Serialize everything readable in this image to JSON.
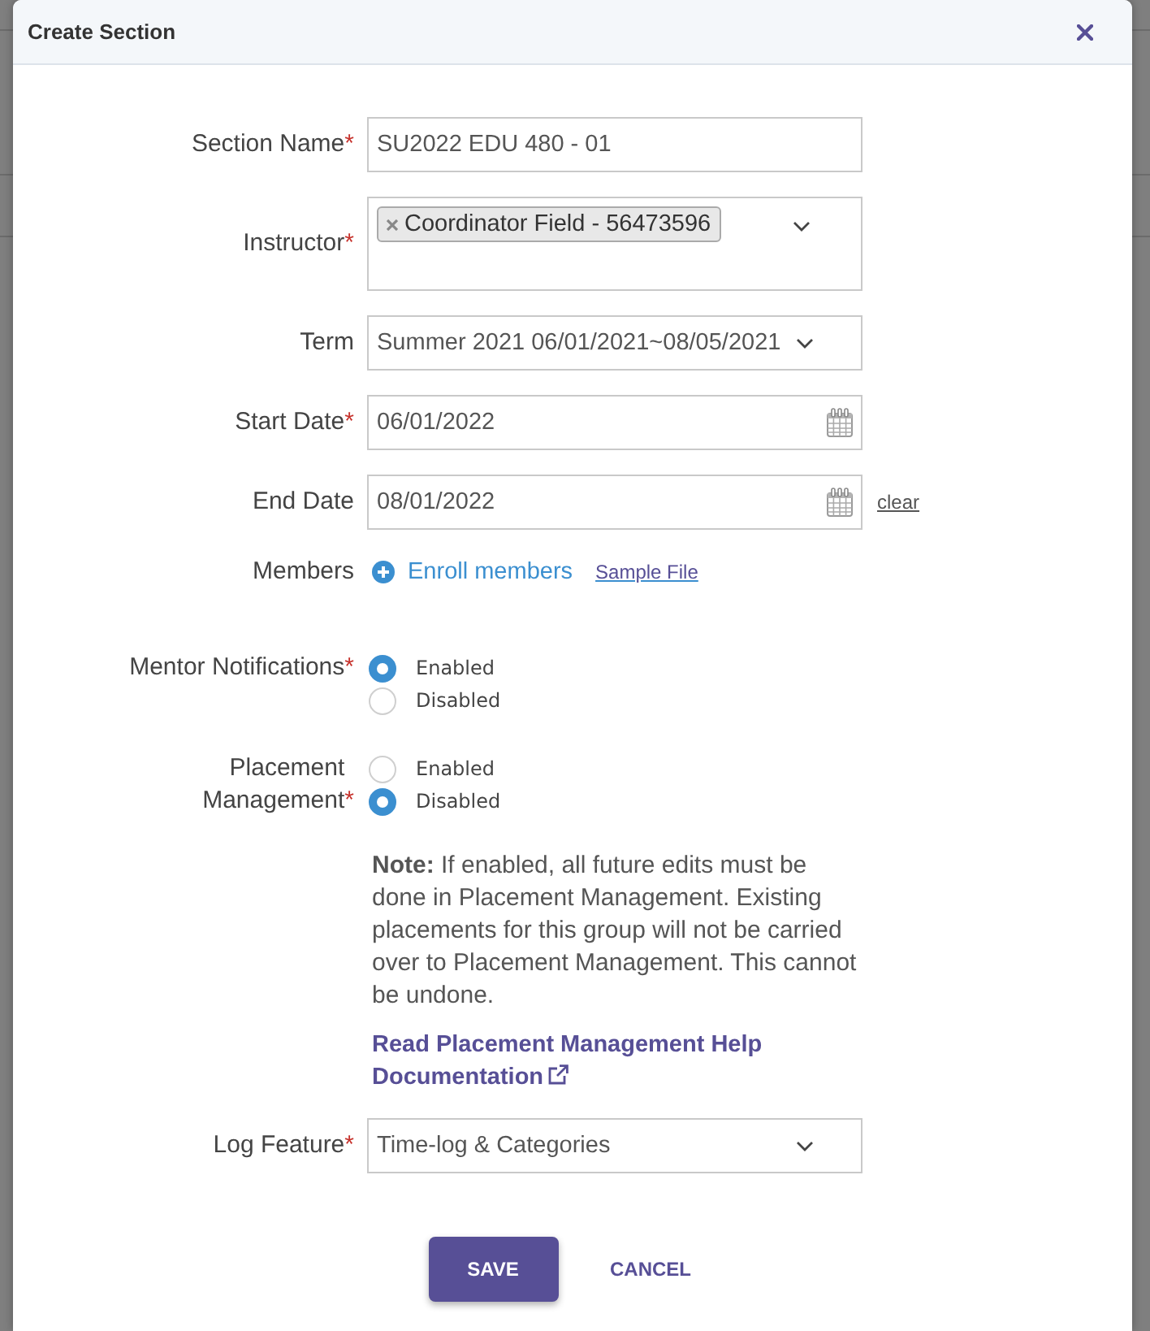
{
  "dialog": {
    "title": "Create Section"
  },
  "form": {
    "fields": [
      {
        "kind": "text",
        "label": "Section Name",
        "required_mark": "*",
        "value": "SU2022 EDU 480 - 01"
      },
      {
        "kind": "multiselect",
        "label": "Instructor",
        "required_mark": "*",
        "tags": [
          "Coordinator Field - 56473596"
        ]
      },
      {
        "kind": "select",
        "label": "Term",
        "value": "Summer 2021 06/01/2021~08/05/2021"
      },
      {
        "kind": "date",
        "label": "Start Date",
        "required_mark": "*",
        "value": "06/01/2022"
      },
      {
        "kind": "date",
        "label": "End Date",
        "value": "08/01/2022",
        "clear_link": "clear"
      },
      {
        "kind": "members",
        "label": "Members",
        "action": "Enroll members",
        "link": "Sample File"
      },
      {
        "kind": "radio",
        "label": "Mentor Notifications",
        "required_mark": "*",
        "options": [
          {
            "label": "Enabled",
            "selected": true
          },
          {
            "label": "Disabled",
            "selected": false
          }
        ]
      },
      {
        "kind": "radio",
        "label": "Placement Management",
        "required_mark": "*",
        "options": [
          {
            "label": "Enabled",
            "selected": false
          },
          {
            "label": "Disabled",
            "selected": true
          }
        ],
        "note": "**Note:** If enabled, all future edits must be done in Placement Management. Existing placements for this group will not be carried over to Placement Management. This cannot be undone.",
        "help_link": "Read Placement Management Help Documentation"
      },
      {
        "kind": "select",
        "label": "Log Feature",
        "required_mark": "*",
        "value": "Time-log & Categories"
      }
    ]
  },
  "buttons": {
    "save": "SAVE",
    "cancel": "CANCEL"
  }
}
